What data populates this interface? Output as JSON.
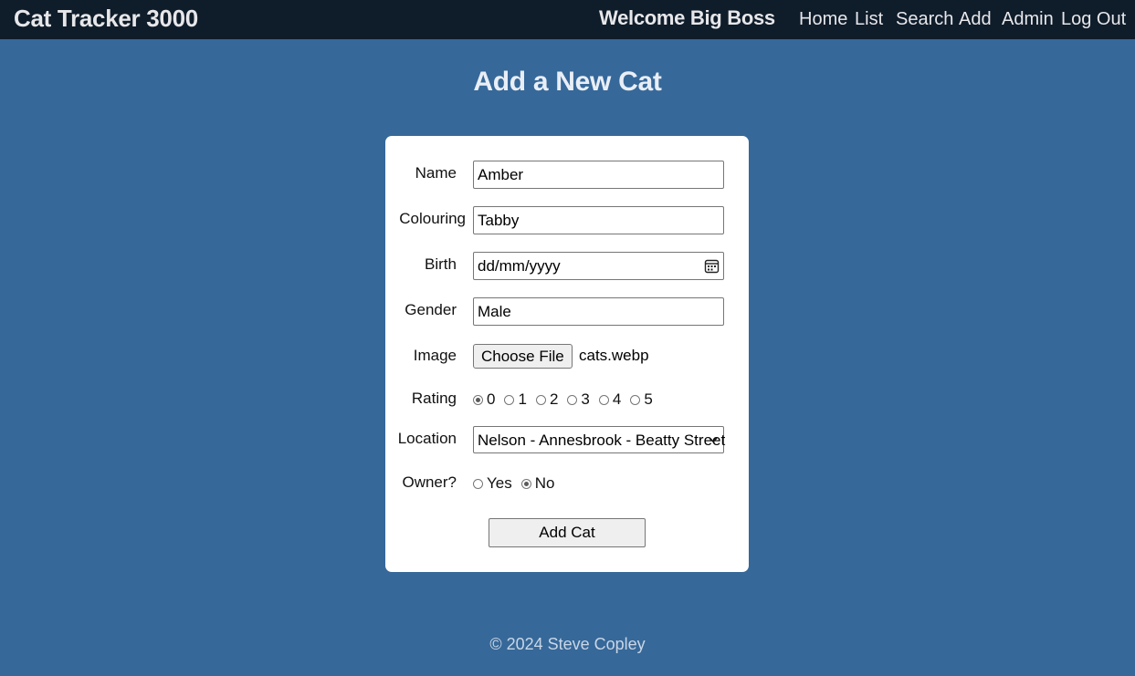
{
  "header": {
    "brand": "Cat Tracker 3000",
    "welcome": "Welcome Big Boss",
    "nav": [
      "Home",
      "List",
      "Search",
      "Add",
      "Admin",
      "Log Out"
    ]
  },
  "page": {
    "title": "Add a New Cat"
  },
  "form": {
    "name_label": "Name",
    "name_value": "Amber",
    "colouring_label": "Colouring",
    "colouring_value": "Tabby",
    "birth_label": "Birth",
    "birth_value": "dd/mm/yyyy",
    "gender_label": "Gender",
    "gender_value": "Male",
    "image_label": "Image",
    "image_button": "Choose File",
    "image_file": "cats.webp",
    "rating_label": "Rating",
    "rating_options": [
      "0",
      "1",
      "2",
      "3",
      "4",
      "5"
    ],
    "rating_selected": "0",
    "location_label": "Location",
    "location_value": "Nelson - Annesbrook - Beatty Street",
    "owner_label": "Owner?",
    "owner_options": [
      "Yes",
      "No"
    ],
    "owner_selected": "No",
    "submit_label": "Add Cat"
  },
  "footer": {
    "text": "© 2024 Steve Copley"
  },
  "colors": {
    "background": "#366899",
    "topbar": "#0f1c2a",
    "card": "#ffffff"
  }
}
